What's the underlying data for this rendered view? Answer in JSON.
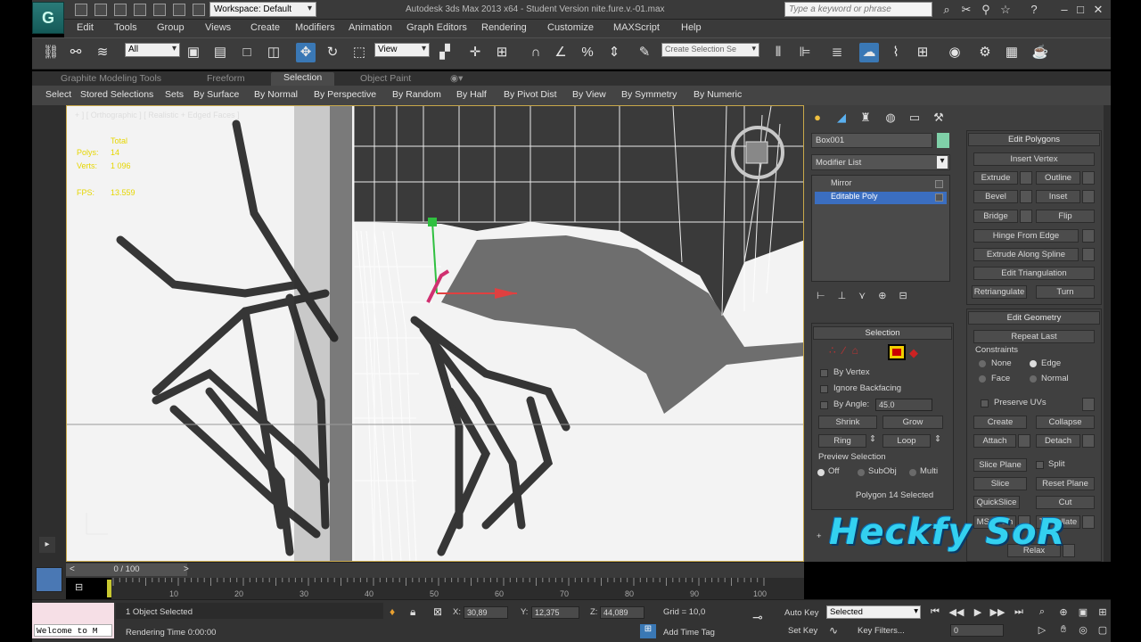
{
  "titlebar": {
    "workspace": "Workspace: Default",
    "window_title": "Autodesk 3ds Max  2013 x64   -  Student Version    nite.fure.v.-01.max",
    "search_placeholder": "Type a keyword or phrase"
  },
  "menu": [
    "Edit",
    "Tools",
    "Group",
    "Views",
    "Create",
    "Modifiers",
    "Animation",
    "Graph Editors",
    "Rendering",
    "Customize",
    "MAXScript",
    "Help"
  ],
  "toolbar": {
    "selection_filter": "All",
    "reference_coord": "View",
    "named_selection": "Create Selection Se"
  },
  "ribbon": {
    "tabs": [
      "Graphite Modeling Tools",
      "Freeform",
      "Selection",
      "Object Paint"
    ],
    "active_tab": "Selection",
    "items": [
      "Select",
      "Stored Selections",
      "Sets",
      "By Surface",
      "By Normal",
      "By Perspective",
      "By Random",
      "By Half",
      "By Pivot Dist",
      "By View",
      "By Symmetry",
      "By Numeric"
    ]
  },
  "viewport": {
    "label": "+ ] [ Orthographic ] [ Realistic + Edged Faces ]",
    "stats": {
      "total": "Total",
      "polys_label": "Polys:",
      "polys_value": "14",
      "verts_label": "Verts:",
      "verts_value": "1 096",
      "fps_label": "FPS:",
      "fps_value": "13.559"
    }
  },
  "command_panel": {
    "object_name": "Box001",
    "modifier_list": "Modifier List",
    "stack": [
      "Mirror",
      "Editable Poly"
    ],
    "edit_polygons": {
      "header": "Edit Polygons",
      "insert_vertex": "Insert Vertex",
      "extrude": "Extrude",
      "outline": "Outline",
      "bevel": "Bevel",
      "inset": "Inset",
      "bridge": "Bridge",
      "flip": "Flip",
      "hinge": "Hinge From Edge",
      "extrude_spline": "Extrude Along Spline",
      "edit_triangulation": "Edit Triangulation",
      "retriangulate": "Retriangulate",
      "turn": "Turn"
    },
    "selection": {
      "header": "Selection",
      "by_vertex": "By Vertex",
      "ignore_backfacing": "Ignore Backfacing",
      "by_angle": "By Angle:",
      "angle_value": "45.0",
      "shrink": "Shrink",
      "grow": "Grow",
      "ring": "Ring",
      "loop": "Loop",
      "preview_title": "Preview Selection",
      "off": "Off",
      "subobj": "SubObj",
      "multi": "Multi",
      "status": "Polygon 14 Selected"
    },
    "edit_geometry": {
      "header": "Edit Geometry",
      "repeat_last": "Repeat Last",
      "constraints": "Constraints",
      "none": "None",
      "edge": "Edge",
      "face": "Face",
      "normal": "Normal",
      "preserve_uvs": "Preserve UVs",
      "create": "Create",
      "collapse": "Collapse",
      "attach": "Attach",
      "detach": "Detach",
      "slice_plane": "Slice Plane",
      "split": "Split",
      "slice": "Slice",
      "reset_plane": "Reset Plane",
      "quickslice": "QuickSlice",
      "cut": "Cut",
      "msmooth": "MSmooth",
      "tessellate": "Tessellate",
      "relax": "Relax"
    }
  },
  "timeline": {
    "frame": "0 / 100",
    "ticks": [
      "10",
      "20",
      "30",
      "40",
      "50",
      "60",
      "70",
      "80",
      "90",
      "100"
    ]
  },
  "status": {
    "maxscript": "Welcome to M",
    "selected": "1 Object Selected",
    "render_time": "Rendering Time  0:00:00",
    "x_label": "X:",
    "x_value": "30,89",
    "y_label": "Y:",
    "y_value": "12,375",
    "z_label": "Z:",
    "z_value": "44,089",
    "grid": "Grid = 10,0",
    "add_time_tag": "Add Time Tag",
    "auto_key": "Auto Key",
    "set_key": "Set Key",
    "auto_key_sel": "Selected",
    "key_filters": "Key Filters...",
    "frame_field": "0"
  },
  "watermark": "Heckfy SoR"
}
